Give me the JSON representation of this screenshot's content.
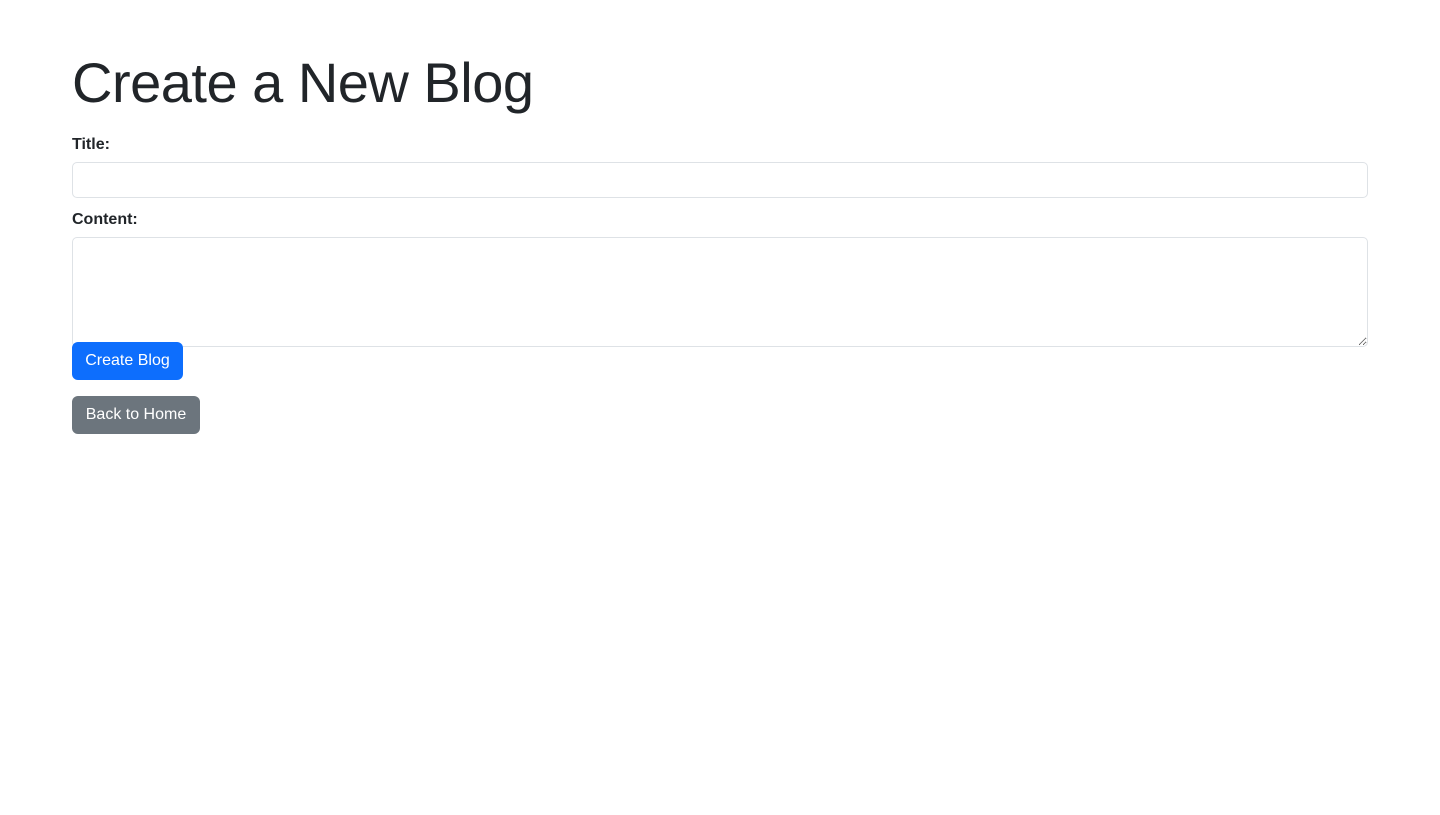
{
  "page": {
    "title": "Create a New Blog"
  },
  "form": {
    "title_label": "Title:",
    "title_value": "",
    "content_label": "Content:",
    "content_value": "",
    "submit_label": "Create Blog"
  },
  "navigation": {
    "back_label": "Back to Home"
  },
  "colors": {
    "primary": "#0d6efd",
    "secondary": "#6c757d",
    "text": "#212529",
    "border": "#dee2e6"
  }
}
